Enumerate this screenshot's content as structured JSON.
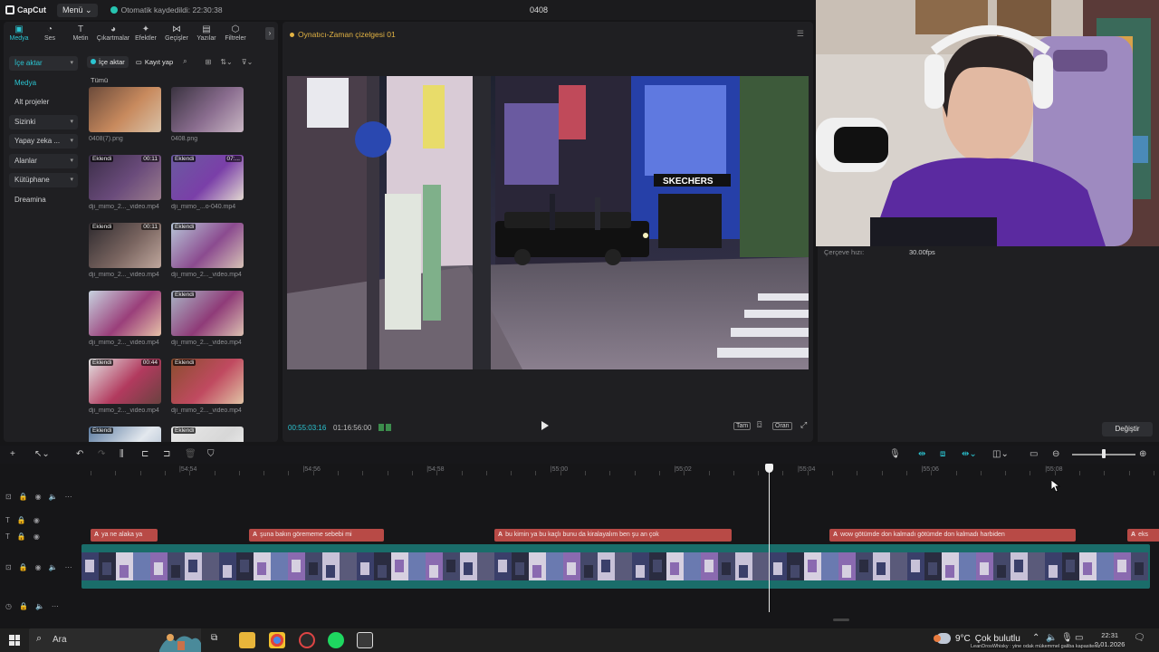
{
  "titlebar": {
    "logo": "CapCut",
    "menu_label": "Menü",
    "autosave_text": "Otomatik kaydedildi: 22:30:38",
    "project_name": "0408"
  },
  "tools": [
    {
      "label": "Medya",
      "glyph": "▣"
    },
    {
      "label": "Ses",
      "glyph": "◔"
    },
    {
      "label": "Metin",
      "glyph": "T"
    },
    {
      "label": "Çıkartmalar",
      "glyph": "◕"
    },
    {
      "label": "Efektler",
      "glyph": "✦"
    },
    {
      "label": "Geçişler",
      "glyph": "⋈"
    },
    {
      "label": "Yazılar",
      "glyph": "▤"
    },
    {
      "label": "Filtreler",
      "glyph": "⬡"
    }
  ],
  "sidenav": [
    {
      "label": "İçe aktar",
      "caret": "▾"
    },
    {
      "label": "Medya",
      "caret": ""
    },
    {
      "label": "Alt projeler",
      "caret": ""
    },
    {
      "label": "Sizinki",
      "caret": "▾"
    },
    {
      "label": "Yapay zeka ...",
      "caret": "▾"
    },
    {
      "label": "Alanlar",
      "caret": "▾"
    },
    {
      "label": "Kütüphane",
      "caret": "▾"
    },
    {
      "label": "Dreamina",
      "caret": ""
    }
  ],
  "media_toolbar": {
    "import_label": "İçe aktar",
    "record_label": "Kayıt yap"
  },
  "all_label": "Tümü",
  "media": [
    {
      "name": "0408(7).png",
      "badge": "",
      "dur": "",
      "colors": [
        "#6b4a3a",
        "#c88a5e",
        "#d9c2a8"
      ]
    },
    {
      "name": "0408.png",
      "badge": "",
      "dur": "",
      "colors": [
        "#3a3340",
        "#8a6d8f",
        "#c9b7c4"
      ]
    },
    {
      "name": "dji_mimo_2..._video.mp4",
      "badge": "Eklendi",
      "dur": "00:11",
      "colors": [
        "#3b2e48",
        "#6a4b7b",
        "#9b7d8e"
      ]
    },
    {
      "name": "dji_mimo_...o-040.mp4",
      "badge": "Eklendi",
      "dur": "07:...",
      "colors": [
        "#6a5aa0",
        "#7a3fa8",
        "#e2d8d0"
      ]
    },
    {
      "name": "dji_mimo_2..._video.mp4",
      "badge": "Eklendi",
      "dur": "00:11",
      "colors": [
        "#2e2a2e",
        "#7a6560",
        "#bfa79d"
      ]
    },
    {
      "name": "dji_mimo_2..._video.mp4",
      "badge": "Eklendi",
      "dur": "",
      "colors": [
        "#b7c6d8",
        "#8b4b8f",
        "#d6c2b6"
      ]
    },
    {
      "name": "dji_mimo_2..._video.mp4",
      "badge": "",
      "dur": "",
      "colors": [
        "#c7d2df",
        "#9a3f7a",
        "#e6c1a8"
      ]
    },
    {
      "name": "dji_mimo_2..._video.mp4",
      "badge": "Eklendi",
      "dur": "",
      "colors": [
        "#a9b6c6",
        "#8f3b78",
        "#dbc0b1"
      ]
    },
    {
      "name": "dji_mimo_2..._video.mp4",
      "badge": "Eklendi",
      "dur": "00:44",
      "colors": [
        "#e4e4e4",
        "#b23a5e",
        "#6a4240"
      ]
    },
    {
      "name": "dji_mimo_2..._video.mp4",
      "badge": "Eklendi",
      "dur": "",
      "colors": [
        "#8a4e2e",
        "#c04a60",
        "#e0c3a5"
      ]
    },
    {
      "name": "",
      "badge": "Eklendi",
      "dur": "",
      "colors": [
        "#5a7aa0",
        "#e3e8ee",
        "#9fb2c8"
      ]
    },
    {
      "name": "",
      "badge": "Eklendi",
      "dur": "",
      "colors": [
        "#e9e9e9",
        "#d7d7d7",
        "#f5f5f5"
      ]
    }
  ],
  "player": {
    "title": "Oynatıcı-Zaman çizelgesi 01",
    "current_time": "00:55:03:16",
    "total_time": "01:16:56:00",
    "btn_full": "Tam",
    "btn_ratio": "Oran"
  },
  "properties": {
    "frame_rate_label": "Çerçeve hızı:",
    "frame_rate_value": "30.00fps",
    "change_label": "Değiştir"
  },
  "ruler": [
    {
      "label": "|54:54"
    },
    {
      "label": "|54:56"
    },
    {
      "label": "|54:58"
    },
    {
      "label": "|55:00"
    },
    {
      "label": "|55:02"
    },
    {
      "label": "|55:04"
    },
    {
      "label": "|55:06"
    },
    {
      "label": "|55:08"
    }
  ],
  "captions": [
    {
      "tag": "A⃞",
      "text": "ya ne alaka ya"
    },
    {
      "tag": "A⃞",
      "text": "şuna bakın görememe sebebi mi"
    },
    {
      "tag": "A⃞",
      "text": "bu kimin ya bu kaçlı bunu da kiralayalım ben şu an çok"
    },
    {
      "tag": "A⃞",
      "text": "wow götümde don kalmadı götümde don kalmadı harbiden"
    },
    {
      "tag": "A⃞",
      "text": "eks"
    }
  ],
  "taskbar": {
    "search_label": "Ara",
    "weather_temp": "9°C",
    "weather_text": "Çok bulutlu",
    "time": "22:31",
    "date": "9.01.2026",
    "ticker": "LeanDrosWhisky : yine odak mükemmel galiba kapasiteniz"
  },
  "colors": {
    "accent": "#2bc5d2",
    "caption_clip": "#b84a46",
    "video_track": "#1a6d6a",
    "player_title": "#e2b344"
  }
}
